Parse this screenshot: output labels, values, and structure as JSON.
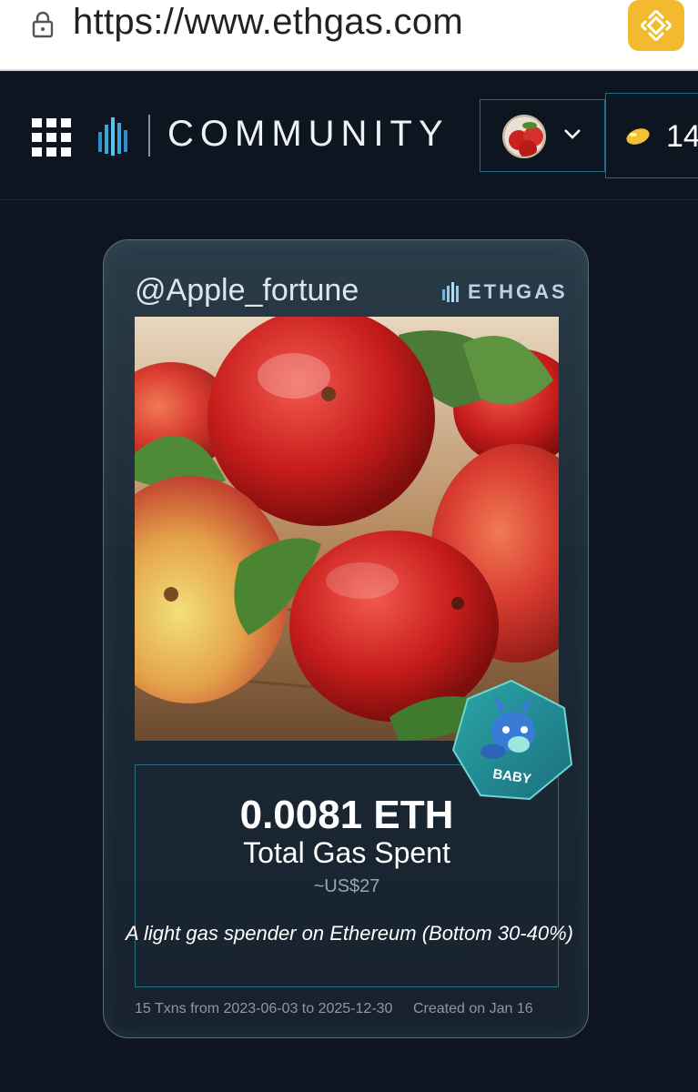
{
  "browser": {
    "url": "https://www.ethgas.com",
    "lock_icon": "lock-icon",
    "extension_icon": "binance-icon"
  },
  "header": {
    "menu_icon": "apps-grid-icon",
    "logo_icon": "ethgas-bars-icon",
    "title": "COMMUNITY",
    "account_icon": "chevron-down-icon",
    "points": "14",
    "points_icon": "bean-icon"
  },
  "card": {
    "handle": "@Apple_fortune",
    "brand": "ETHGAS",
    "gas_value": "0.0081 ETH",
    "gas_label": "Total Gas Spent",
    "usd_value": "~US$27",
    "description": "A light gas spender on Ethereum (Bottom 30-40%)",
    "tx_range": "15 Txns from 2023-06-03 to 2025-12-30",
    "created": "Created on Jan 16",
    "badge_label": "BABY"
  },
  "colors": {
    "background": "#0e1520",
    "accent_border": "#1f6f86",
    "brand_logo": "#3fb5e0",
    "binance_yellow": "#f3ba2f"
  }
}
